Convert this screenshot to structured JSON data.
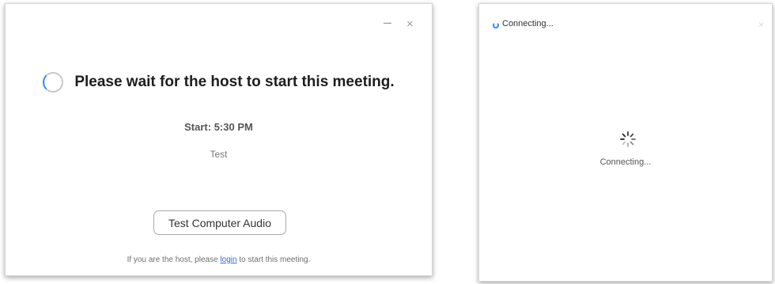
{
  "waiting_window": {
    "minimize_glyph": "–",
    "close_glyph": "×",
    "title": "Please wait for the host to start this meeting.",
    "start_time": "Start: 5:30 PM",
    "meeting_name": "Test",
    "audio_button_label": "Test Computer Audio",
    "host_prefix": "If you are the host, please",
    "login_link": "login",
    "host_suffix": "to start this meeting.",
    "icons": [
      "loading-ring-icon",
      "minimize-icon",
      "close-icon"
    ],
    "accent_color": "#2d8cff"
  },
  "connecting_window": {
    "title": "Connecting...",
    "close_glyph": "×",
    "status": "Connecting...",
    "icons": [
      "zoom-logo-icon",
      "close-icon",
      "spinner-icon"
    ]
  }
}
